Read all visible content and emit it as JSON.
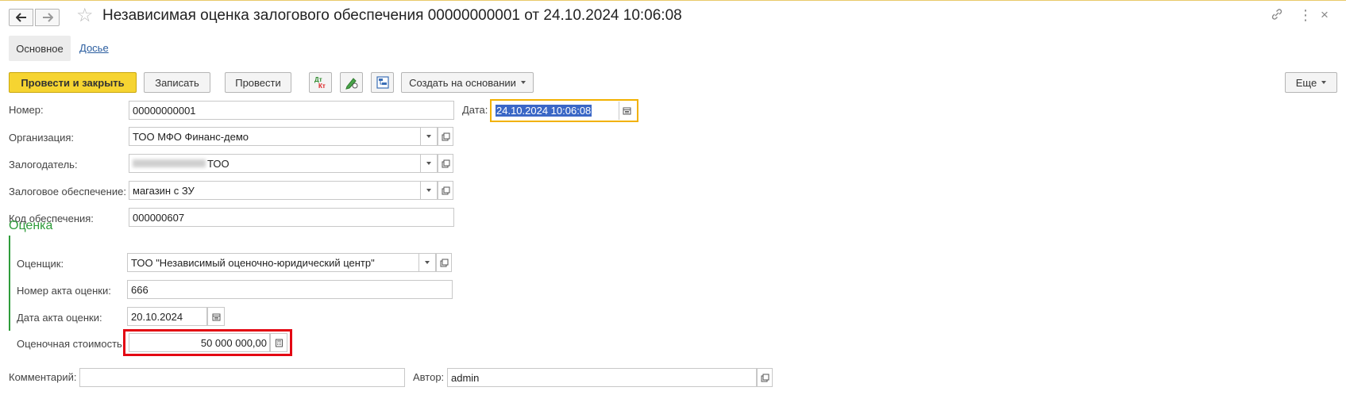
{
  "window": {
    "title": "Независимая оценка залогового обеспечения 00000000001 от 24.10.2024 10:06:08",
    "back_icon": "arrow-left-icon",
    "forward_icon": "arrow-right-icon",
    "favorite_icon": "star-icon",
    "link_icon": "link-icon",
    "more_icon": "kebab-icon",
    "close_icon": "close-icon"
  },
  "tabs": {
    "main": "Основное",
    "dossier": "Досье"
  },
  "toolbar": {
    "post_close": "Провести и закрыть",
    "save": "Записать",
    "post": "Провести",
    "create_based": "Создать на основании",
    "more": "Еще",
    "icons": [
      "dt-kt-icon",
      "edit-icon",
      "structure-icon"
    ]
  },
  "form": {
    "number_label": "Номер:",
    "number": "00000000001",
    "date_label": "Дата:",
    "date": "24.10.2024 10:06:08",
    "org_label": "Организация:",
    "org": "ТОО МФО Финанс-демо",
    "pledgor_label": "Залогодатель:",
    "pledgor": "ТОО",
    "collateral_label": "Залоговое обеспечение:",
    "collateral": "магазин с ЗУ",
    "code_label": "Код обеспечения:",
    "code": "000000607"
  },
  "assessment": {
    "section_title": "Оценка",
    "appraiser_label": "Оценщик:",
    "appraiser": "ТОО \"Независимый оценочно-юридический центр\"",
    "act_number_label": "Номер акта оценки:",
    "act_number": "666",
    "act_date_label": "Дата акта оценки:",
    "act_date": "20.10.2024",
    "value_label": "Оценочная стоимость:",
    "value": "50 000 000,00"
  },
  "footer": {
    "comment_label": "Комментарий:",
    "comment": "",
    "author_label": "Автор:",
    "author": "admin"
  },
  "colors": {
    "primary_button": "#f6d431",
    "section": "#2e9c3a",
    "highlight": "#e30613",
    "focus": "#f2b100"
  }
}
